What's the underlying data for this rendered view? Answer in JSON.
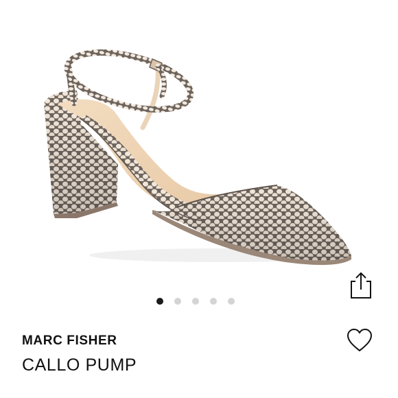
{
  "product": {
    "brand": "MARC FISHER",
    "name": "CALLO PUMP",
    "image_alt": "snakeskin print block-heel pointed-toe pump"
  },
  "gallery": {
    "total": 5,
    "active_index": 0
  },
  "actions": {
    "share_icon": "share-icon",
    "like_icon": "heart-icon"
  },
  "colors": {
    "dot_active": "#1a1a1a",
    "dot_inactive": "#d4d4d4",
    "text": "#111111"
  }
}
